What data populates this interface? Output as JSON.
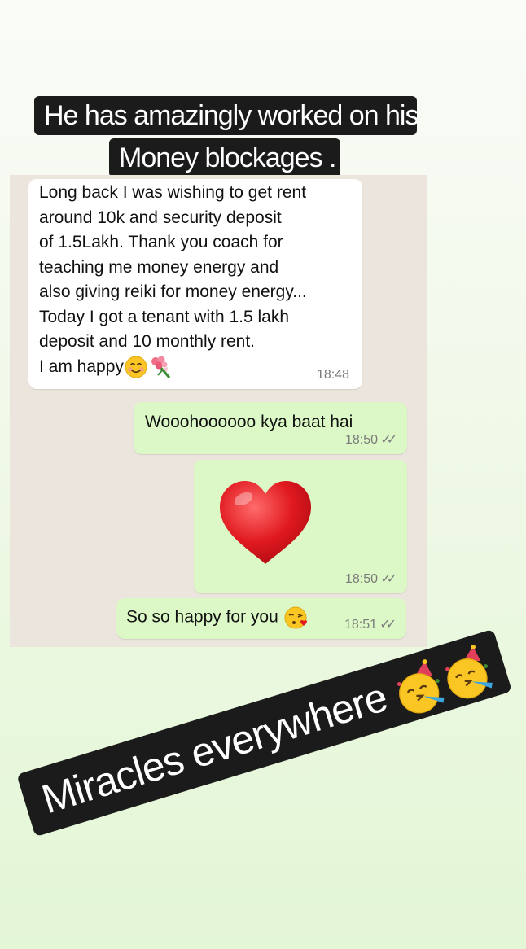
{
  "caption": {
    "line1": "He has amazingly worked on his",
    "line2": "Money blockages ."
  },
  "chat": {
    "messages": [
      {
        "direction": "incoming",
        "lines": [
          "Long back I was wishing to get rent",
          "around 10k and security deposit",
          "of 1.5Lakh. Thank you coach for",
          "teaching me money energy and",
          "also giving reiki for money energy...",
          "Today I got a tenant with 1.5 lakh",
          "deposit and 10 monthly rent.",
          "I am happy"
        ],
        "emojis": [
          "smiling-face-emoji",
          "bouquet-emoji"
        ],
        "time": "18:48"
      },
      {
        "direction": "outgoing",
        "text": "Wooohoooooo kya baat hai",
        "time": "18:50",
        "read_ticks": "double-check-icon"
      },
      {
        "direction": "outgoing",
        "sticker": "red-heart-emoji",
        "time": "18:50",
        "read_ticks": "double-check-icon"
      },
      {
        "direction": "outgoing",
        "text": "So so happy for you",
        "emoji": "face-blowing-kiss-emoji",
        "time": "18:51",
        "read_ticks": "double-check-icon"
      }
    ]
  },
  "banner": {
    "text": "Miracles everywhere",
    "emojis": [
      "partying-face-emoji",
      "partying-face-emoji"
    ]
  },
  "colors": {
    "incoming_bubble": "#ffffff",
    "outgoing_bubble": "#dcf8c6",
    "chat_background": "#ece5dd",
    "caption_background": "#1b1b1b",
    "heart": "#e0191f"
  }
}
